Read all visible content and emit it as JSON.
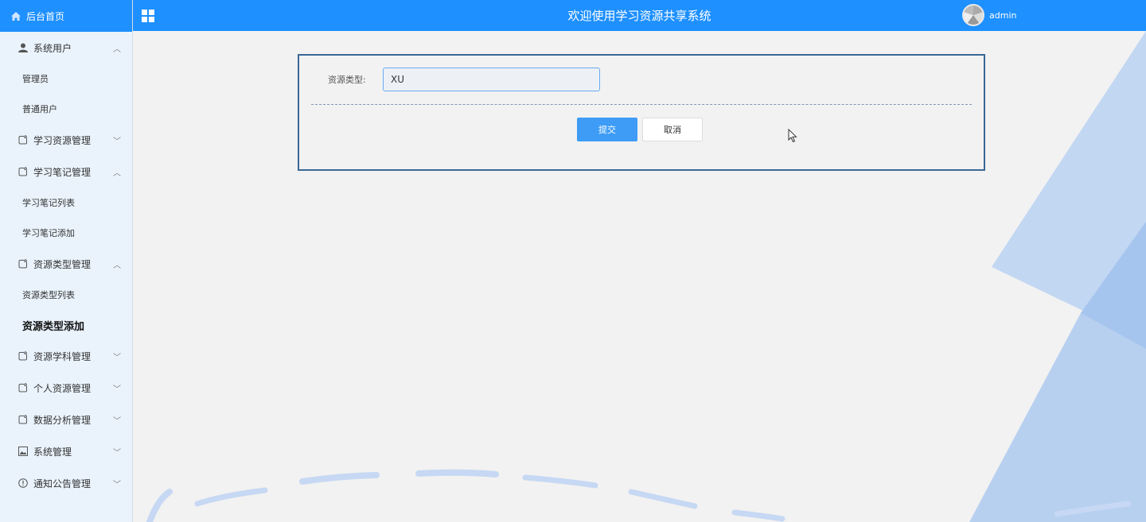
{
  "sidebar": {
    "home_label": "后台首页",
    "groups": [
      {
        "label": "系统用户",
        "expanded": true,
        "items": [
          "管理员",
          "普通用户"
        ]
      },
      {
        "label": "学习资源管理",
        "expanded": false,
        "items": []
      },
      {
        "label": "学习笔记管理",
        "expanded": true,
        "items": [
          "学习笔记列表",
          "学习笔记添加"
        ]
      },
      {
        "label": "资源类型管理",
        "expanded": true,
        "items": [
          "资源类型列表",
          "资源类型添加"
        ]
      },
      {
        "label": "资源学科管理",
        "expanded": false,
        "items": []
      },
      {
        "label": "个人资源管理",
        "expanded": false,
        "items": []
      },
      {
        "label": "数据分析管理",
        "expanded": false,
        "items": []
      },
      {
        "label": "系统管理",
        "expanded": false,
        "items": []
      },
      {
        "label": "通知公告管理",
        "expanded": false,
        "items": []
      }
    ],
    "active_item": "资源类型添加"
  },
  "header": {
    "title": "欢迎使用学习资源共享系统",
    "username": "admin"
  },
  "form": {
    "field_label": "资源类型:",
    "field_value": "XU",
    "submit_label": "提交",
    "cancel_label": "取消"
  },
  "colors": {
    "primary": "#1e90ff",
    "sidebar_bg": "#eaf3fc",
    "panel_border": "#3a6795",
    "submit_bg": "#3e9cf7"
  }
}
